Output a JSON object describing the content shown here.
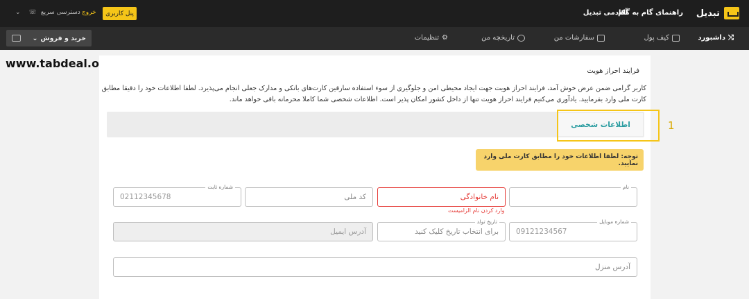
{
  "topbar": {
    "brand": "تبدیل",
    "nav_guide": "راهنمای گام به گام",
    "nav_academy": "آکادمی تبدیل",
    "user_panel": "پنل کاربری",
    "exit": "خروج",
    "quick_access": "دسترسی سریع"
  },
  "secbar": {
    "items": [
      {
        "label": "داشبورد",
        "icon": "dashboard-icon"
      },
      {
        "label": "کیف پول",
        "icon": "wallet-icon"
      },
      {
        "label": "سفارشات من",
        "icon": "orders-icon"
      },
      {
        "label": "تاریخچه من",
        "icon": "history-icon"
      },
      {
        "label": "تنظیمات",
        "icon": "settings-icon"
      }
    ],
    "trade": "خرید و فروش"
  },
  "watermark": "www.tabdeal.org",
  "content": {
    "title": "فرایند احراز هویت",
    "paragraph": "کاربر گرامی ضمن عرض خوش آمد، فرایند احراز هویت جهت ایجاد محیطی امن و جلوگیری از سوء استفاده سارقین کارت‌های بانکی و مدارک جعلی انجام می‌پذیرد. لطفا اطلاعات خود را دقیقا مطابق کارت ملی وارد بفرمایید. یادآوری می‌کنیم فرایند احراز هویت تنها از داخل کشور امکان پذیر است. اطلاعات شخصی شما کاملا محرمانه باقی خواهد ماند.",
    "tab_personal": "اطلاعات شخصی",
    "step_marker": "1",
    "notice": "توجه: لطفا اطلاعات خود را مطابق کارت ملی وارد نمایید."
  },
  "form": {
    "first_name_label": "نام",
    "last_name_placeholder": "نام خانوادگی",
    "last_name_error": "وارد کردن نام الزامیست",
    "national_code_placeholder": "کد ملی",
    "landline_label": "شماره ثابت",
    "landline_placeholder": "02112345678",
    "mobile_label": "شماره موبایل",
    "mobile_placeholder": "09121234567",
    "birthdate_label": "تاریخ تولد",
    "birthdate_placeholder": "برای انتخاب تاریخ کلیک کنید",
    "email_placeholder": "آدرس ایمیل",
    "address_placeholder": "آدرس منزل"
  },
  "colors": {
    "accent_yellow": "#f5c518",
    "teal": "#2a9ca0",
    "error_red": "#e53935"
  }
}
